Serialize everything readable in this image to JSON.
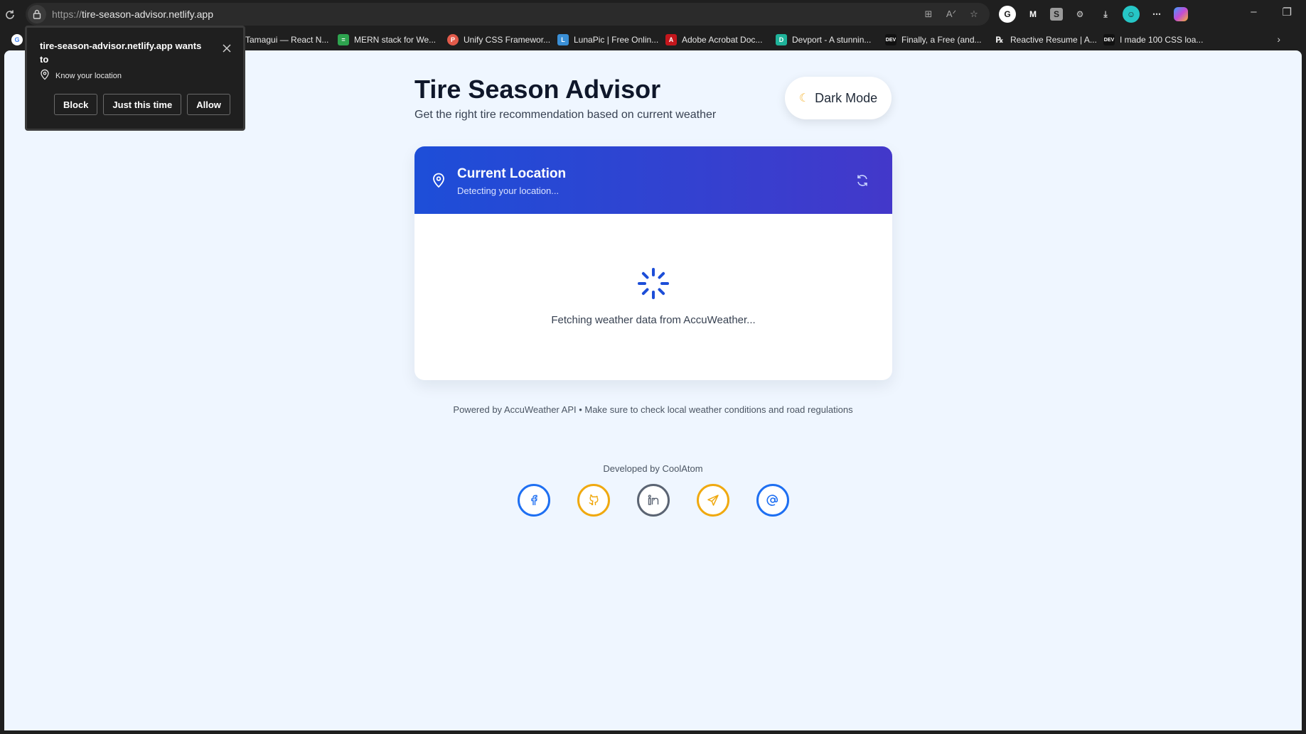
{
  "browser": {
    "url_scheme": "https://",
    "url_host": "tire-season-advisor.netlify.app",
    "bookmarks": [
      {
        "label": "Tamagui — React N...",
        "color": "#f0f0f0"
      },
      {
        "label": "MERN stack for We...",
        "color": "#2ea44f"
      },
      {
        "label": "Unify CSS Framewor...",
        "color": "#e25a4a"
      },
      {
        "label": "LunaPic | Free Onlin...",
        "color": "#3a8fd6"
      },
      {
        "label": "Adobe Acrobat Doc...",
        "color": "#c4161c"
      },
      {
        "label": "Devport - A stunnin...",
        "color": "#1fb39a"
      },
      {
        "label": "Finally, a Free (and...",
        "color": "#111111"
      },
      {
        "label": "Reactive Resume | A...",
        "color": "#1f1f1f"
      },
      {
        "label": "I made 100 CSS loa...",
        "color": "#111111"
      }
    ]
  },
  "permission": {
    "title": "tire-season-advisor.netlify.app wants to",
    "request": "Know your location",
    "buttons": {
      "block": "Block",
      "once": "Just this time",
      "allow": "Allow"
    }
  },
  "header": {
    "title": "Tire Season Advisor",
    "subtitle": "Get the right tire recommendation based on current weather",
    "dark_mode_label": "Dark Mode"
  },
  "card": {
    "location_title": "Current Location",
    "location_status": "Detecting your location...",
    "loading_text": "Fetching weather data from AccuWeather..."
  },
  "footer": {
    "powered": "Powered by AccuWeather API • Make sure to check local weather conditions and road regulations",
    "developed_by": "Developed by CoolAtom",
    "socials": [
      {
        "name": "facebook",
        "color": "#1e6ff2"
      },
      {
        "name": "github",
        "color": "#f0a90f"
      },
      {
        "name": "linkedin",
        "color": "#5b6473"
      },
      {
        "name": "telegram",
        "color": "#f0a90f"
      },
      {
        "name": "email",
        "color": "#1e6ff2"
      }
    ]
  },
  "colors": {
    "header_gradient_start": "#1d4ed8",
    "header_gradient_end": "#4338ca",
    "page_bg": "#eff6ff",
    "spinner": "#1d4ed8"
  }
}
